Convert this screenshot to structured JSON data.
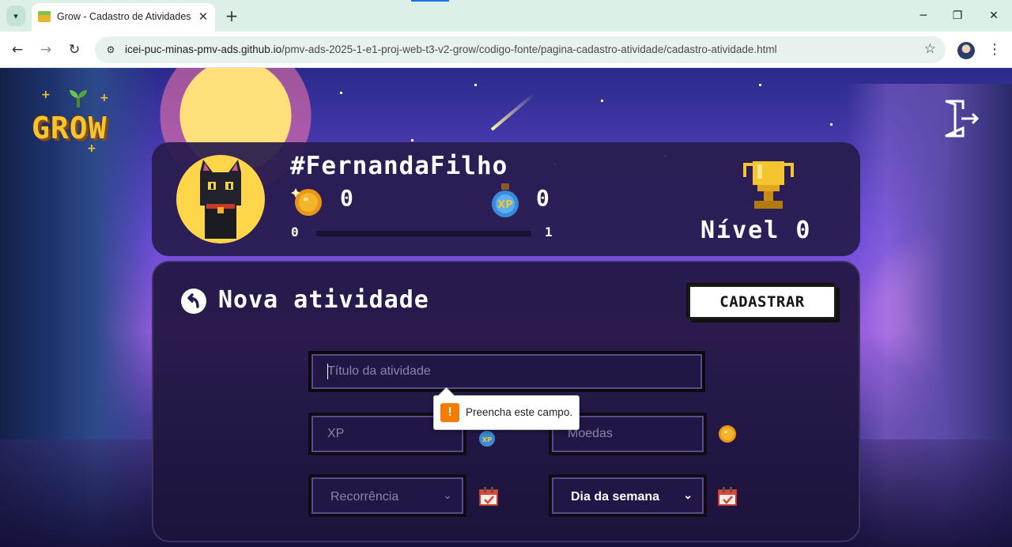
{
  "browser": {
    "tab_title": "Grow - Cadastro de Atividades",
    "url_host": "icei-puc-minas-pmv-ads.github.io",
    "url_path": "/pmv-ads-2025-1-e1-proj-web-t3-v2-grow/codigo-fonte/pagina-cadastro-atividade/cadastro-atividade.html"
  },
  "brand": {
    "logo_text": "GROW"
  },
  "profile": {
    "username": "#FernandaFilho",
    "coins": "0",
    "xp": "0",
    "progress_min": "0",
    "progress_max": "1",
    "progress_fraction": 0,
    "level_label": "Nível 0"
  },
  "form": {
    "title": "Nova atividade",
    "submit_label": "CADASTRAR",
    "title_placeholder": "Título da atividade",
    "xp_placeholder": "XP",
    "coins_placeholder": "Moedas",
    "recurrence_value": "Recorrência",
    "weekday_value": "Dia da semana"
  },
  "validation": {
    "message": "Preencha este campo."
  },
  "icons": {
    "back": "back-arrow-icon",
    "exit": "exit-door-icon",
    "coin": "coin-icon",
    "xp": "xp-potion-icon",
    "trophy": "trophy-icon",
    "calendar": "calendar-icon",
    "warning": "warning-icon"
  },
  "colors": {
    "accent_gold": "#f5c431",
    "card_bg": "#281c4e",
    "tooltip_warning": "#f57c00"
  }
}
